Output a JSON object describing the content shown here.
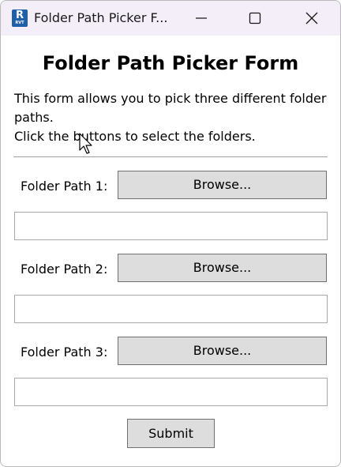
{
  "window": {
    "title": "Folder Path Picker F...",
    "app_icon": {
      "letter": "R",
      "sub": "RVT",
      "name": "revit-app-icon",
      "color": "#1f5ea8"
    },
    "controls": [
      "minimize-icon",
      "maximize-icon",
      "close-icon"
    ]
  },
  "form": {
    "heading": "Folder Path Picker Form",
    "description_line1": "This form allows you to pick three different folder",
    "description_line2": "paths.",
    "description_line3": "Click the buttons to select the folders.",
    "rows": [
      {
        "label": "Folder Path 1:",
        "button": "Browse...",
        "value": ""
      },
      {
        "label": "Folder Path 2:",
        "button": "Browse...",
        "value": ""
      },
      {
        "label": "Folder Path 3:",
        "button": "Browse...",
        "value": ""
      }
    ],
    "submit": "Submit"
  },
  "colors": {
    "titlebar": "#f3eef8",
    "button_bg": "#dddddd",
    "button_border": "#707070"
  }
}
